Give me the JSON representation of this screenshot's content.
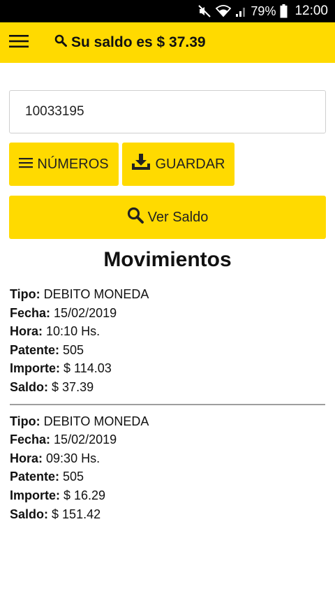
{
  "status_bar": {
    "battery_pct": "79%",
    "time": "12:00",
    "icons": [
      "mute-icon",
      "wifi-icon",
      "signal-icon",
      "battery-icon"
    ]
  },
  "app_bar": {
    "title": "Su saldo es $ 37.39",
    "color": "#FFDA00"
  },
  "card_input": {
    "value": "10033195"
  },
  "buttons": {
    "numeros": "NÚMEROS",
    "guardar": "GUARDAR",
    "ver_saldo": "Ver Saldo"
  },
  "section_title": "Movimientos",
  "labels": {
    "tipo": "Tipo:",
    "fecha": "Fecha:",
    "hora": "Hora:",
    "patente": "Patente:",
    "importe": "Importe:",
    "saldo": "Saldo:"
  },
  "movements": [
    {
      "tipo": "DEBITO MONEDA",
      "fecha": "15/02/2019",
      "hora": "10:10 Hs.",
      "patente": "505",
      "importe": "$ 114.03",
      "saldo": "$ 37.39"
    },
    {
      "tipo": "DEBITO MONEDA",
      "fecha": "15/02/2019",
      "hora": "09:30 Hs.",
      "patente": "505",
      "importe": "$ 16.29",
      "saldo": "$ 151.42"
    }
  ]
}
